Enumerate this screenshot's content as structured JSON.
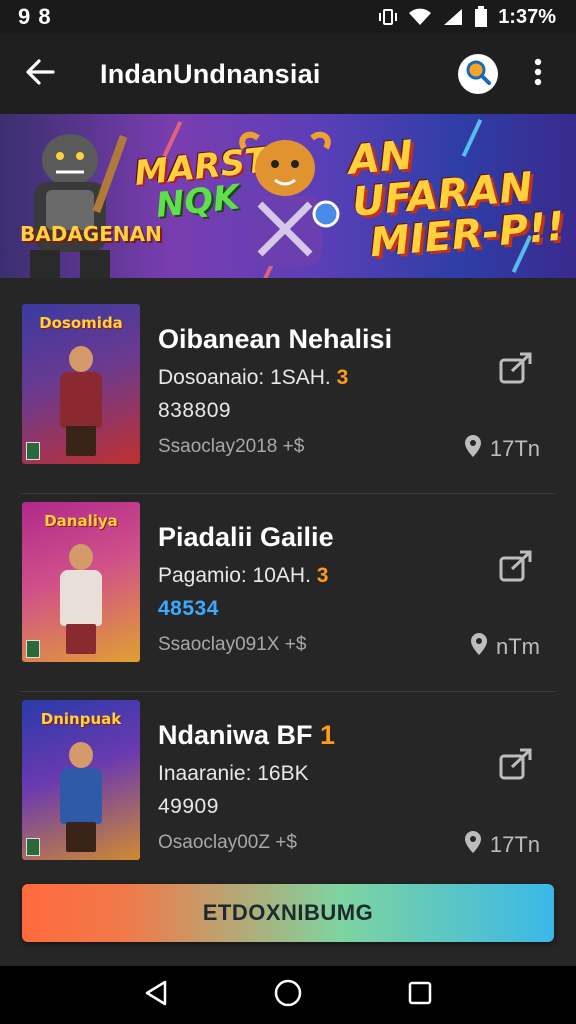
{
  "status_bar": {
    "left": "9 8",
    "time": "1:37%"
  },
  "app_bar": {
    "title": "IndanUndnansiai"
  },
  "banner": {
    "left_line1": "MARST",
    "left_line2": "NQK",
    "right_line1": "AN UFARAN",
    "right_line2": "MIER-P!!",
    "logo": "BADAGENAN"
  },
  "games": [
    {
      "thumb_title": "Dosomida",
      "name": "Oibanean Nehalisi",
      "meta_text": "Dosoanaio: 1SAH.",
      "meta_highlight": "3",
      "rank": "838809",
      "rank_style": "normal",
      "size": "Ssaoclay2018 +$",
      "players": "17Tn",
      "colors": {
        "bg1": "#3a3aa0",
        "bg2": "#c03030",
        "body": "#8a2a30"
      }
    },
    {
      "thumb_title": "Danaliya",
      "name": "Piadalii Gailie",
      "meta_text": "Pagamio: 10AH.",
      "meta_highlight": "3",
      "rank": "48534",
      "rank_style": "blue",
      "size": "Ssaoclay091X +$",
      "players": "nTm",
      "colors": {
        "bg1": "#b02a8a",
        "bg2": "#e0a030",
        "body": "#e8e0d8"
      }
    },
    {
      "thumb_title": "Dninpuak",
      "name": "Ndaniwa BF",
      "name_highlight": "1",
      "meta_text": "Inaaranie: 16BK",
      "meta_highlight": "",
      "rank": "49909",
      "rank_style": "normal",
      "size": "Osaoclay00Z +$",
      "players": "17Tn",
      "colors": {
        "bg1": "#2a3aa8",
        "bg2": "#d08a30",
        "body": "#2e5aa8"
      }
    }
  ],
  "cta": {
    "label": "ETDOXNIBUMG"
  },
  "accent": {
    "orange": "#ff9a1a",
    "blue": "#3aaaff"
  }
}
